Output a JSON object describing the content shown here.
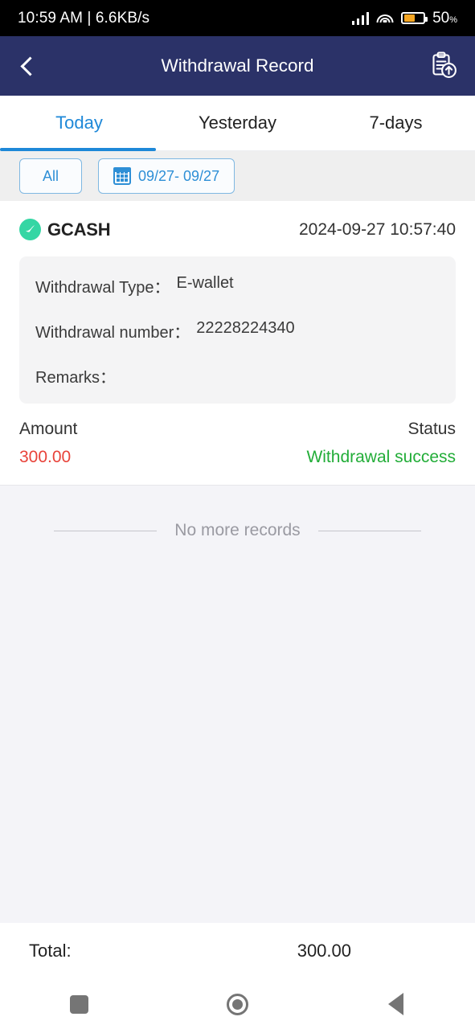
{
  "status_bar": {
    "time_and_network": "10:59 AM | 6.6KB/s",
    "battery_percent": "50",
    "battery_percent_symbol": "%",
    "battery_level": 50,
    "signal_icon": "cellular-signal-icon",
    "wifi_icon": "wifi-icon",
    "battery_icon": "battery-icon",
    "battery_fill_color": "#F5A623"
  },
  "appbar": {
    "title": "Withdrawal Record",
    "back_icon": "back-chevron-icon",
    "action_icon": "clipboard-upload-icon",
    "background_color": "#2B3268"
  },
  "tabs": {
    "active_index": 0,
    "accent_color": "#1E88D8",
    "items": [
      {
        "label": "Today"
      },
      {
        "label": "Yesterday"
      },
      {
        "label": "7-days"
      }
    ]
  },
  "filters": {
    "all_label": "All",
    "date_range_label": "09/27- 09/27",
    "calendar_icon": "calendar-icon",
    "chip_color": "#2E8FD6"
  },
  "records": [
    {
      "brand": "GCASH",
      "brand_icon": "gcash-check-icon",
      "brand_icon_color": "#35D6A4",
      "timestamp": "2024-09-27 10:57:40",
      "details": [
        {
          "label": "Withdrawal Type：",
          "value": "E-wallet"
        },
        {
          "label": "Withdrawal number：",
          "value": "22228224340"
        },
        {
          "label": "Remarks：",
          "value": ""
        }
      ],
      "amount_label": "Amount",
      "amount_value": "300.00",
      "amount_color": "#E8433A",
      "status_label": "Status",
      "status_value": "Withdrawal success",
      "status_color": "#22AD38"
    }
  ],
  "empty_state": {
    "text": "No more records"
  },
  "footer": {
    "total_label": "Total:",
    "total_value": "300.00"
  },
  "nav_bar": {
    "recents_icon": "recents-square-icon",
    "home_icon": "home-circle-icon",
    "back_icon": "back-triangle-icon"
  }
}
